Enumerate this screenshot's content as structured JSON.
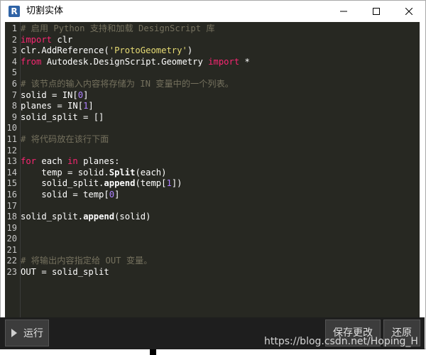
{
  "window": {
    "title": "切割实体",
    "icon_letter": "R",
    "icon_color": "#2f63a6"
  },
  "editor": {
    "lines": [
      {
        "n": "1",
        "tokens": [
          {
            "t": "comment",
            "v": "# 启用 Python 支持和加载 DesignScript 库"
          }
        ]
      },
      {
        "n": "2",
        "tokens": [
          {
            "t": "kw",
            "v": "import"
          },
          {
            "t": "plain",
            "v": " clr"
          }
        ]
      },
      {
        "n": "3",
        "tokens": [
          {
            "t": "plain",
            "v": "clr.AddReference("
          },
          {
            "t": "str",
            "v": "'ProtoGeometry'"
          },
          {
            "t": "plain",
            "v": ")"
          }
        ]
      },
      {
        "n": "4",
        "tokens": [
          {
            "t": "kw",
            "v": "from"
          },
          {
            "t": "plain",
            "v": " Autodesk.DesignScript.Geometry "
          },
          {
            "t": "kw",
            "v": "import"
          },
          {
            "t": "plain",
            "v": " *"
          }
        ]
      },
      {
        "n": "5",
        "tokens": []
      },
      {
        "n": "6",
        "tokens": [
          {
            "t": "comment",
            "v": "# 该节点的输入内容将存储为 IN 变量中的一个列表。"
          }
        ]
      },
      {
        "n": "7",
        "tokens": [
          {
            "t": "plain",
            "v": "solid = IN["
          },
          {
            "t": "num",
            "v": "0"
          },
          {
            "t": "plain",
            "v": "]"
          }
        ]
      },
      {
        "n": "8",
        "tokens": [
          {
            "t": "plain",
            "v": "planes = IN["
          },
          {
            "t": "num",
            "v": "1"
          },
          {
            "t": "plain",
            "v": "]"
          }
        ]
      },
      {
        "n": "9",
        "tokens": [
          {
            "t": "plain",
            "v": "solid_split = []"
          }
        ]
      },
      {
        "n": "10",
        "tokens": []
      },
      {
        "n": "11",
        "tokens": [
          {
            "t": "comment",
            "v": "# 将代码放在该行下面"
          }
        ]
      },
      {
        "n": "12",
        "tokens": []
      },
      {
        "n": "13",
        "tokens": [
          {
            "t": "kw",
            "v": "for"
          },
          {
            "t": "plain",
            "v": " each "
          },
          {
            "t": "kw",
            "v": "in"
          },
          {
            "t": "plain",
            "v": " planes:"
          }
        ]
      },
      {
        "n": "14",
        "tokens": [
          {
            "t": "plain",
            "v": "    temp = solid."
          },
          {
            "t": "fn",
            "v": "Split"
          },
          {
            "t": "plain",
            "v": "(each)"
          }
        ]
      },
      {
        "n": "15",
        "tokens": [
          {
            "t": "plain",
            "v": "    solid_split."
          },
          {
            "t": "fn",
            "v": "append"
          },
          {
            "t": "plain",
            "v": "(temp["
          },
          {
            "t": "num",
            "v": "1"
          },
          {
            "t": "plain",
            "v": "])"
          }
        ]
      },
      {
        "n": "16",
        "tokens": [
          {
            "t": "plain",
            "v": "    solid = temp["
          },
          {
            "t": "num",
            "v": "0"
          },
          {
            "t": "plain",
            "v": "]"
          }
        ]
      },
      {
        "n": "17",
        "tokens": []
      },
      {
        "n": "18",
        "tokens": [
          {
            "t": "plain",
            "v": "solid_split."
          },
          {
            "t": "fn",
            "v": "append"
          },
          {
            "t": "plain",
            "v": "(solid)"
          }
        ]
      },
      {
        "n": "19",
        "tokens": []
      },
      {
        "n": "20",
        "tokens": []
      },
      {
        "n": "21",
        "tokens": []
      },
      {
        "n": "22",
        "tokens": [
          {
            "t": "comment",
            "v": "# 将输出内容指定给 OUT 变量。"
          }
        ]
      },
      {
        "n": "23",
        "tokens": [
          {
            "t": "plain",
            "v": "OUT = solid_split"
          }
        ]
      }
    ]
  },
  "toolbar": {
    "run_label": "运行",
    "save_label": "保存更改",
    "revert_label": "还原"
  },
  "watermark": "https://blog.csdn.net/Hoping_H",
  "colors": {
    "editor_bg": "#272822",
    "comment": "#75715e",
    "keyword": "#f92672",
    "string": "#e6db74",
    "number": "#ae81ff",
    "text": "#ffffff"
  }
}
